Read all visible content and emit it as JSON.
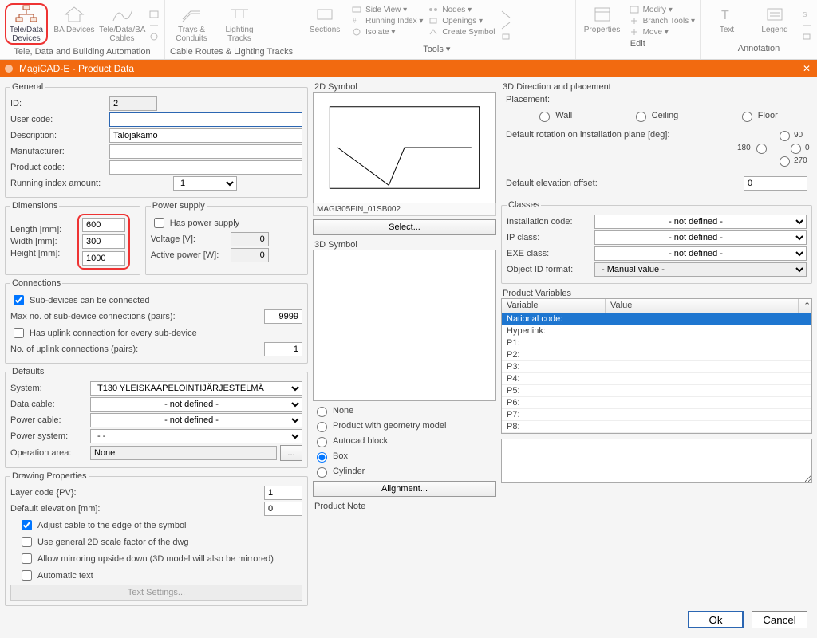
{
  "ribbon": {
    "group1": {
      "label": "Tele, Data and Building Automation",
      "tele_data_devices": "Tele/Data Devices",
      "ba_devices": "BA Devices",
      "tele_data_ba_cables": "Tele/Data/BA Cables"
    },
    "group2": {
      "label": "Cable Routes & Lighting Tracks",
      "trays_conduits": "Trays & Conduits",
      "lighting_tracks": "Lighting Tracks"
    },
    "group3": {
      "label": "Tools ▾",
      "sections": "Sections",
      "side_view": "Side View ▾",
      "running_index": "Running Index ▾",
      "isolate": "Isolate ▾",
      "nodes": "Nodes ▾",
      "openings": "Openings ▾",
      "create_symbol": "Create Symbol"
    },
    "group4": {
      "label": "Edit",
      "properties": "Properties",
      "modify": "Modify ▾",
      "branch_tools": "Branch Tools ▾",
      "move": "Move ▾"
    },
    "group5": {
      "label": "Annotation",
      "text": "Text",
      "legend": "Legend"
    }
  },
  "dialog": {
    "title": "MagiCAD-E - Product Data",
    "close": "✕"
  },
  "general": {
    "legend": "General",
    "id_label": "ID:",
    "id_value": "2",
    "user_code_label": "User code:",
    "user_code_value": "",
    "description_label": "Description:",
    "description_value": "Talojakamo",
    "manufacturer_label": "Manufacturer:",
    "manufacturer_value": "",
    "product_code_label": "Product code:",
    "product_code_value": "",
    "running_index_label": "Running index amount:",
    "running_index_value": "1"
  },
  "dimensions": {
    "legend": "Dimensions",
    "length_label": "Length [mm]:",
    "length_value": "600",
    "width_label": "Width [mm]:",
    "width_value": "300",
    "height_label": "Height [mm]:",
    "height_value": "1000"
  },
  "power_supply": {
    "legend": "Power supply",
    "has_power": "Has power supply",
    "voltage_label": "Voltage [V]:",
    "voltage_value": "0",
    "active_power_label": "Active power [W]:",
    "active_power_value": "0"
  },
  "connections": {
    "legend": "Connections",
    "sub_devices": "Sub-devices can be connected",
    "max_sub_label": "Max no. of sub-device connections (pairs):",
    "max_sub_value": "9999",
    "has_uplink": "Has uplink connection for every sub-device",
    "no_uplink_label": "No. of uplink connections (pairs):",
    "no_uplink_value": "1"
  },
  "defaults": {
    "legend": "Defaults",
    "system_label": "System:",
    "system_value": "T130       YLEISKAAPELOINTIJÄRJESTELMÄ",
    "data_cable_label": "Data cable:",
    "data_cable_value": "- not defined -",
    "power_cable_label": "Power cable:",
    "power_cable_value": "- not defined -",
    "power_system_label": "Power system:",
    "power_system_value": "-            -",
    "operation_area_label": "Operation area:",
    "operation_area_value": "None",
    "browse": "..."
  },
  "drawing": {
    "legend": "Drawing Properties",
    "layer_code_label": "Layer code {PV}:",
    "layer_code_value": "1",
    "default_elevation_label": "Default elevation [mm]:",
    "default_elevation_value": "0",
    "adjust_cable": "Adjust cable to the edge of the symbol",
    "use_general_2d": "Use general 2D scale factor of the dwg",
    "allow_mirror": "Allow mirroring upside down (3D model will also be mirrored)",
    "automatic_text": "Automatic text",
    "text_settings": "Text Settings..."
  },
  "symbol2d": {
    "legend": "2D Symbol",
    "code": "MAGI305FIN_01SB002",
    "select": "Select..."
  },
  "symbol3d": {
    "legend": "3D Symbol",
    "none": "None",
    "geom": "Product with geometry model",
    "autocad": "Autocad block",
    "box": "Box",
    "cylinder": "Cylinder",
    "alignment": "Alignment..."
  },
  "direction": {
    "legend": "3D Direction and placement",
    "placement_label": "Placement:",
    "wall": "Wall",
    "ceiling": "Ceiling",
    "floor": "Floor",
    "rotation_label": "Default rotation on installation plane [deg]:",
    "r90": "90",
    "r180": "180",
    "r0": "0",
    "r270": "270",
    "elevation_label": "Default elevation offset:",
    "elevation_value": "0"
  },
  "classes": {
    "legend": "Classes",
    "installation_code_label": "Installation code:",
    "installation_code_value": "- not defined -",
    "ip_class_label": "IP class:",
    "ip_class_value": "- not defined -",
    "exe_class_label": "EXE class:",
    "exe_class_value": "- not defined -",
    "object_id_label": "Object ID format:",
    "object_id_value": "- Manual value -"
  },
  "product_variables": {
    "legend": "Product Variables",
    "head_variable": "Variable",
    "head_value": "Value",
    "rows": [
      "National code:",
      "Hyperlink:",
      "P1:",
      "P2:",
      "P3:",
      "P4:",
      "P5:",
      "P6:",
      "P7:",
      "P8:"
    ]
  },
  "product_note": {
    "legend": "Product Note"
  },
  "footer": {
    "ok": "Ok",
    "cancel": "Cancel"
  }
}
